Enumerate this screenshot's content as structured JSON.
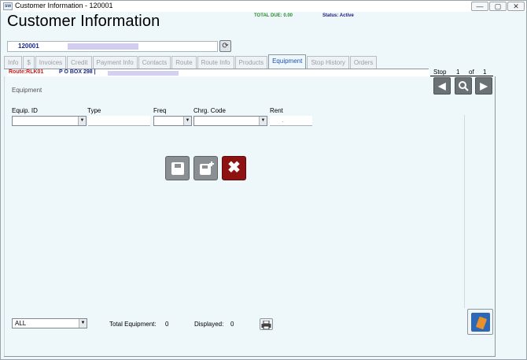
{
  "window": {
    "title": "Customer Information - 120001",
    "icon_label": "sw",
    "controls": {
      "minimize": "—",
      "maximize": "▢",
      "close": "✕"
    }
  },
  "header": {
    "title": "Customer Information",
    "total_due": "TOTAL DUE:  0.00",
    "status": "Status: Active"
  },
  "customer": {
    "id": "120001",
    "refresh_icon": "refresh-icon"
  },
  "tabs": [
    {
      "label": "Info",
      "active": false
    },
    {
      "label": "$",
      "active": false
    },
    {
      "label": "Invoices",
      "active": false
    },
    {
      "label": "Credit",
      "active": false
    },
    {
      "label": "Payment Info",
      "active": false
    },
    {
      "label": "Contacts",
      "active": false
    },
    {
      "label": "Route",
      "active": false
    },
    {
      "label": "Route Info",
      "active": false
    },
    {
      "label": "Products",
      "active": false
    },
    {
      "label": "Equipment",
      "active": true
    },
    {
      "label": "Stop History",
      "active": false
    },
    {
      "label": "Orders",
      "active": false
    }
  ],
  "route": {
    "code": "Route:RLK01",
    "address": "P O BOX 298 |"
  },
  "stop_nav": {
    "label": "Stop",
    "current": "1",
    "of": "of",
    "total": "1"
  },
  "equipment": {
    "section_title": "Equipment",
    "columns": {
      "equip_id": "Equip. ID",
      "type": "Type",
      "freq": "Freq",
      "charge_code": "Chrg. Code",
      "rent": "Rent"
    },
    "rent_value": "."
  },
  "footer": {
    "filter_value": "ALL",
    "total_equipment_label": "Total Equipment:",
    "total_equipment_value": "0",
    "displayed_label": "Displayed:",
    "displayed_value": "0"
  },
  "colors": {
    "accent_tab": "#1f4fb3",
    "route_code": "#d21a1a",
    "total_due": "#2e8a2e",
    "delete_button": "#8e1212"
  }
}
